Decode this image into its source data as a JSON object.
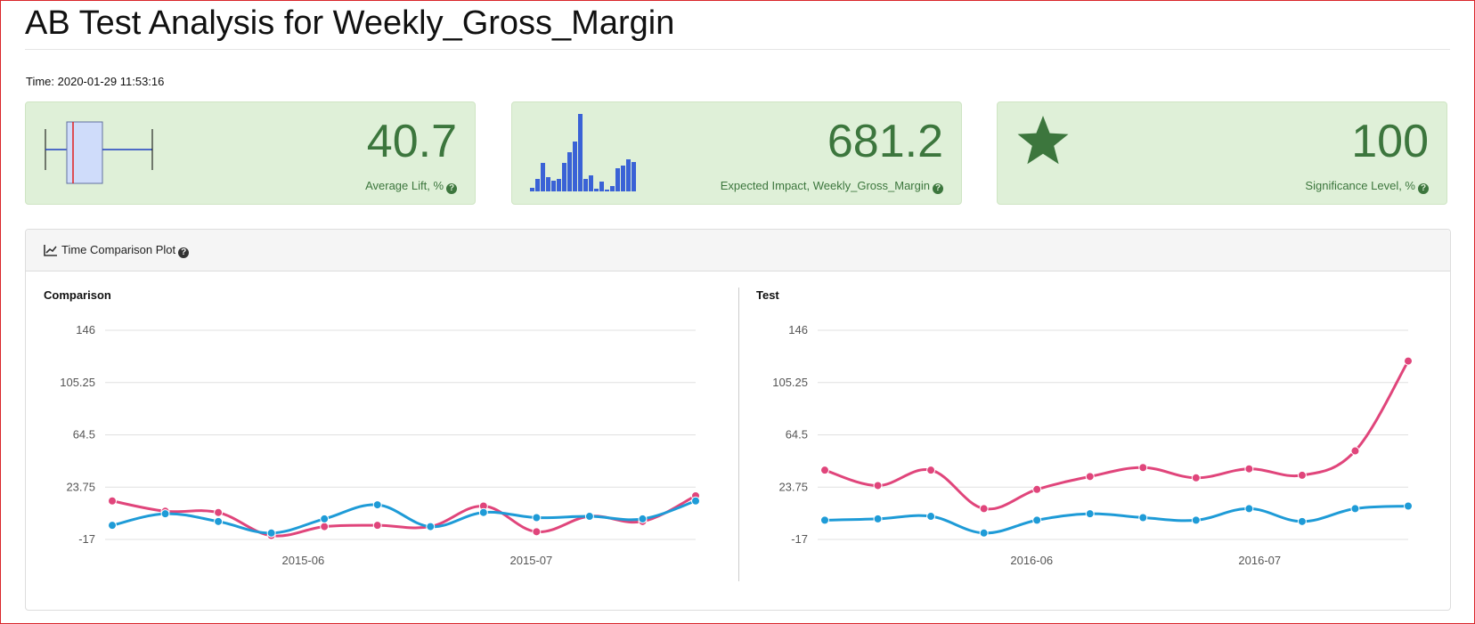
{
  "page": {
    "title": "AB Test Analysis for Weekly_Gross_Margin",
    "time": "Time: 2020-01-29 11:53:16"
  },
  "kpis": [
    {
      "value": "40.7",
      "label": "Average Lift, %",
      "icon": "boxplot-icon"
    },
    {
      "value": "681.2",
      "label": "Expected Impact, Weekly_Gross_Margin",
      "icon": "histogram-icon"
    },
    {
      "value": "100",
      "label": "Significance Level, %",
      "icon": "star-icon"
    }
  ],
  "panel": {
    "title": "Time Comparison Plot",
    "icon": "line-chart-icon"
  },
  "colors": {
    "series_a": "#e0457b",
    "series_b": "#1e9bd7",
    "kpi_bg": "#dff0d8",
    "kpi_text": "#3c763d",
    "bar": "#3a62d6"
  },
  "chart_data": [
    {
      "type": "line",
      "title": "Comparison",
      "y_ticks": [
        "146",
        "105.25",
        "64.5",
        "23.75",
        "-17"
      ],
      "ylim": [
        -17,
        146
      ],
      "x_labels": [
        "2015-06",
        "2015-07"
      ],
      "x_label_index": [
        3.6,
        7.9
      ],
      "series": [
        {
          "values": [
            13,
            5,
            4,
            -14,
            -7,
            -6,
            -7,
            9,
            -11,
            1,
            -3,
            17
          ]
        },
        {
          "values": [
            -6,
            3,
            -3,
            -12,
            -1,
            10,
            -7,
            4,
            0,
            1,
            -1,
            13
          ]
        }
      ]
    },
    {
      "type": "line",
      "title": "Test",
      "y_ticks": [
        "146",
        "105.25",
        "64.5",
        "23.75",
        "-17"
      ],
      "ylim": [
        -17,
        146
      ],
      "x_labels": [
        "2016-06",
        "2016-07"
      ],
      "x_label_index": [
        3.9,
        8.2
      ],
      "series": [
        {
          "values": [
            37,
            25,
            37,
            7,
            22,
            32,
            39,
            31,
            38,
            33,
            52,
            122
          ]
        },
        {
          "values": [
            -2,
            -1,
            1,
            -12,
            -2,
            3,
            0,
            -2,
            7,
            -3,
            7,
            9
          ]
        }
      ]
    }
  ]
}
